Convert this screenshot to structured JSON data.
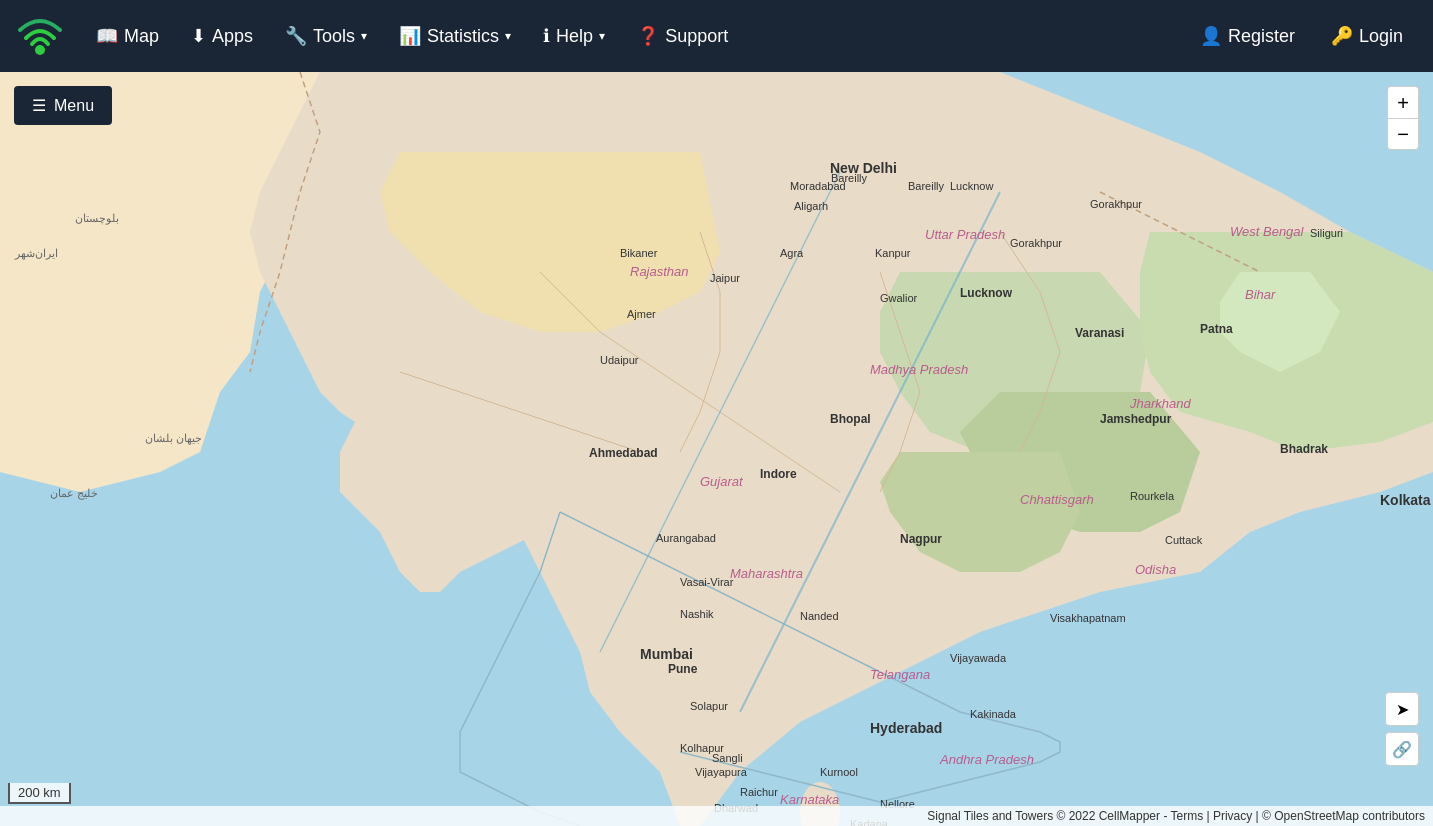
{
  "navbar": {
    "logo_alt": "CellMapper Logo",
    "items": [
      {
        "id": "map",
        "label": "Map",
        "icon": "📖",
        "has_dropdown": false
      },
      {
        "id": "apps",
        "label": "Apps",
        "icon": "⬇",
        "has_dropdown": false
      },
      {
        "id": "tools",
        "label": "Tools",
        "icon": "🔧",
        "has_dropdown": true
      },
      {
        "id": "statistics",
        "label": "Statistics",
        "icon": "📊",
        "has_dropdown": true
      },
      {
        "id": "help",
        "label": "Help",
        "icon": "ℹ",
        "has_dropdown": true
      },
      {
        "id": "support",
        "label": "Support",
        "icon": "?",
        "has_dropdown": false
      }
    ],
    "right_items": [
      {
        "id": "register",
        "label": "Register",
        "icon": "👤+"
      },
      {
        "id": "login",
        "label": "Login",
        "icon": "→"
      }
    ]
  },
  "map": {
    "menu_label": "Menu",
    "zoom_in_label": "+",
    "zoom_out_label": "−",
    "scale_label": "200 km",
    "attribution": "Signal Tiles and Towers © 2022 CellMapper - Terms | Privacy | © OpenStreetMap contributors"
  }
}
